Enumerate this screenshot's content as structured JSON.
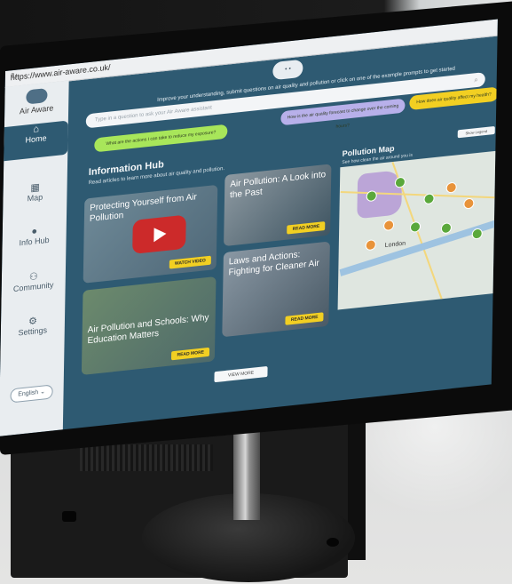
{
  "browser": {
    "url": "https://www.air-aware.co.uk/"
  },
  "app": {
    "name": "Air Aware",
    "intro": "Improve your understanding, submit questions on air quality and pollution or click on one of the example prompts to get started"
  },
  "sidebar": {
    "items": [
      {
        "label": "Home",
        "icon": "home-icon",
        "active": true
      },
      {
        "label": "Map",
        "icon": "map-icon",
        "active": false
      },
      {
        "label": "Info Hub",
        "icon": "info-icon",
        "active": false
      },
      {
        "label": "Community",
        "icon": "community-icon",
        "active": false
      },
      {
        "label": "Settings",
        "icon": "gear-icon",
        "active": false
      }
    ],
    "language": "English"
  },
  "search": {
    "placeholder": "Type in a question to ask your Air Aware assistant"
  },
  "prompts": [
    "What are the actions I can take to reduce my exposure?",
    "How is the air quality forecast to change over the coming hours?",
    "How does air quality affect my health?"
  ],
  "info_hub": {
    "title": "Information Hub",
    "subtitle": "Read articles to learn more about air quality and pollution.",
    "cards": [
      {
        "title": "Protecting Yourself from Air Pollution",
        "button": "WATCH VIDEO"
      },
      {
        "title": "Air Pollution: A Look into the Past",
        "button": "READ MORE"
      },
      {
        "title": "Air Pollution and Schools: Why Education Matters",
        "button": "READ MORE"
      },
      {
        "title": "Laws and Actions: Fighting for Cleaner Air",
        "button": "READ MORE"
      }
    ],
    "view_more": "VIEW MORE"
  },
  "pollution_map": {
    "title": "Pollution Map",
    "subtitle": "See how clean the air around you is",
    "legend_button": "Show Legend",
    "city_label": "London"
  }
}
